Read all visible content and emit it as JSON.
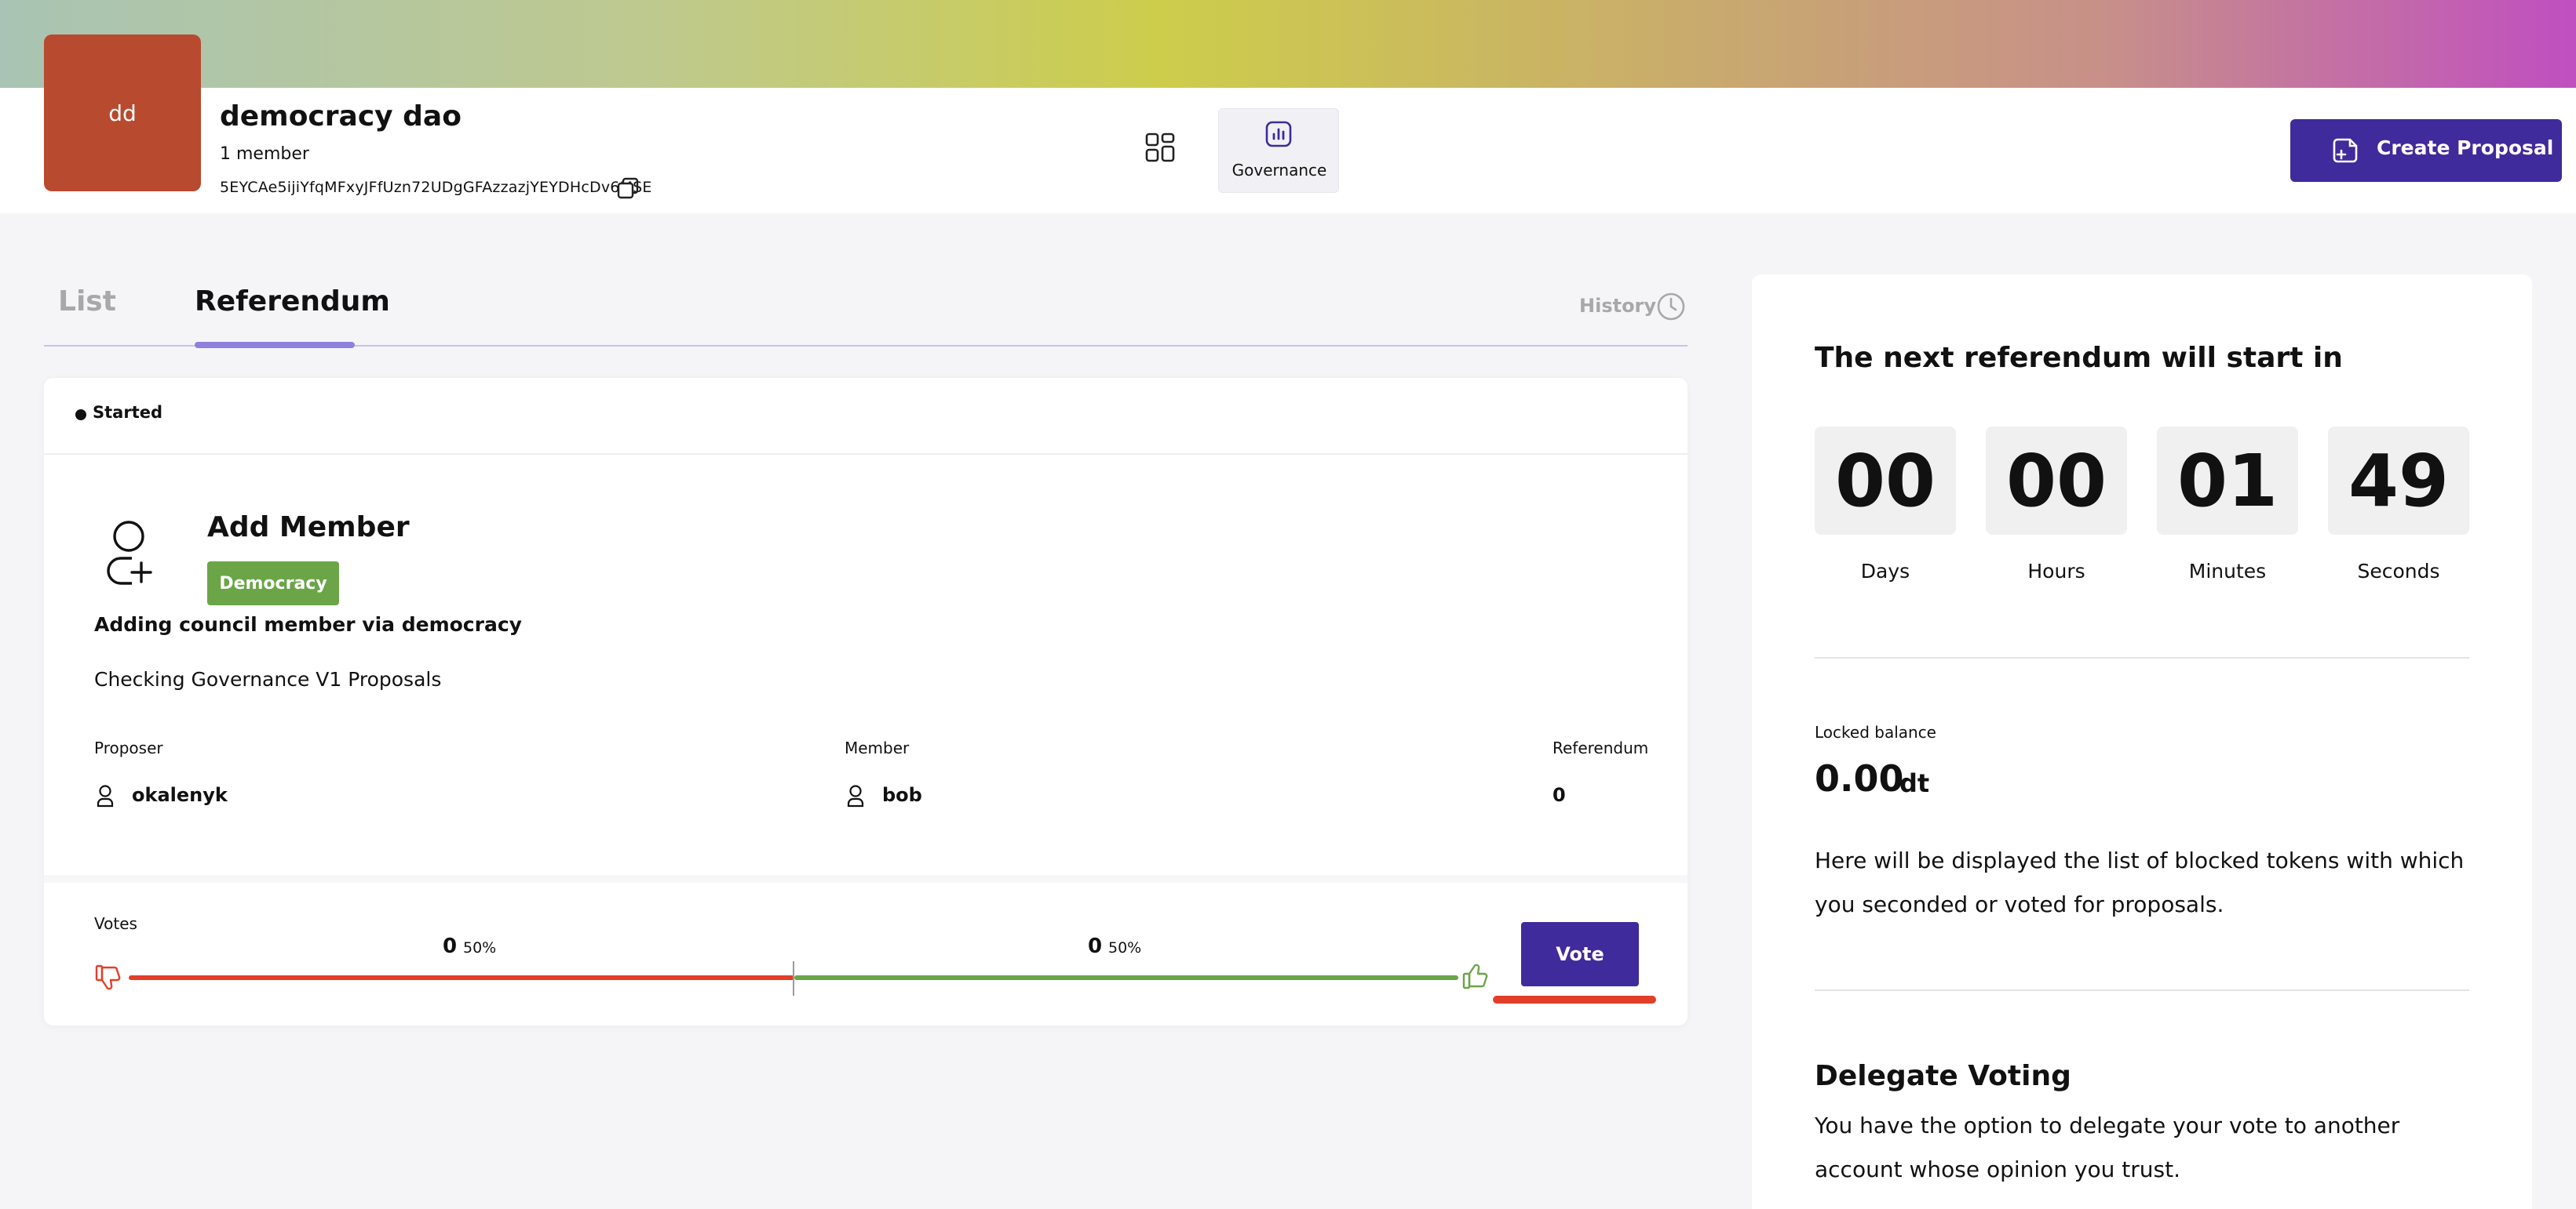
{
  "header": {
    "avatar_initials": "dd",
    "dao_name": "democracy dao",
    "members": "1 member",
    "address": "5EYCAe5ijiYfqMFxyJFfUzn72UDgGFAzzazjYEYDHcDv6MSE",
    "nav_governance_label": "Governance",
    "create_proposal_label": "Create Proposal"
  },
  "tabs": {
    "list_label": "List",
    "referendum_label": "Referendum",
    "history_label": "History"
  },
  "proposal": {
    "status": "Started",
    "title": "Add Member",
    "badge": "Democracy",
    "subtitle": "Adding council member via democracy",
    "description": "Checking Governance V1 Proposals",
    "proposer_label": "Proposer",
    "proposer_value": "okalenyk",
    "member_label": "Member",
    "member_value": "bob",
    "referendum_label": "Referendum",
    "referendum_value": "0"
  },
  "votes": {
    "label": "Votes",
    "against_count": "0",
    "against_pct": "50%",
    "for_count": "0",
    "for_pct": "50%",
    "vote_button_label": "Vote"
  },
  "sidebar": {
    "countdown_title": "The next referendum will start in",
    "countdown": [
      {
        "value": "00",
        "label": "Days"
      },
      {
        "value": "00",
        "label": "Hours"
      },
      {
        "value": "01",
        "label": "Minutes"
      },
      {
        "value": "49",
        "label": "Seconds"
      }
    ],
    "locked_balance_label": "Locked balance",
    "locked_balance_value": "0.00",
    "locked_balance_unit": "dt",
    "locked_info": "Here will be displayed the list of blocked tokens with which you seconded or voted for proposals.",
    "delegate_title": "Delegate Voting",
    "delegate_text": "You have the option to delegate your vote to another account whose opinion you trust."
  },
  "colors": {
    "accent": "#3f2b9b",
    "avatar": "#b84a2f",
    "badge_green": "#6ba548",
    "against_red": "#e23e2a",
    "tab_underline": "#8f80dd"
  },
  "icons": [
    "copy-icon",
    "dashboard-grid-icon",
    "governance-chart-icon",
    "create-proposal-icon",
    "history-clock-icon",
    "add-user-icon",
    "person-icon",
    "thumbs-down-icon",
    "thumbs-up-icon"
  ]
}
